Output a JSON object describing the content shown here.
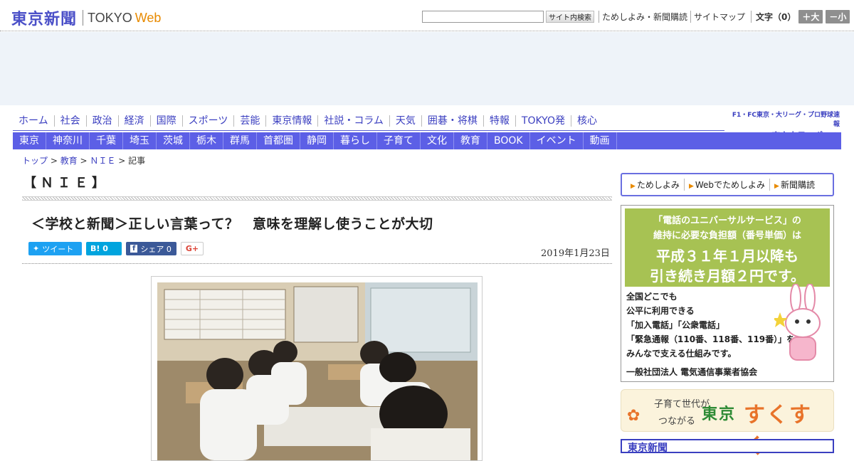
{
  "header": {
    "logo_jp": "東京新聞",
    "logo_tokyo": "TOKYO",
    "logo_web": "Web",
    "search_button": "サイト内検索",
    "links": [
      "ためしよみ・新聞購読",
      "サイトマップ"
    ],
    "font_size_label": "文字（0）",
    "font_up": "＋大",
    "font_down": "－小"
  },
  "nav_main": [
    "ホーム",
    "社会",
    "政治",
    "経済",
    "国際",
    "スポーツ",
    "芸能",
    "東京情報",
    "社説・コラム",
    "天気",
    "囲碁・将棋",
    "特報",
    "TOKYO発",
    "核心"
  ],
  "chunichi": {
    "small": "F1・FC東京・大リーグ・プロ野球速報",
    "big": "東京中日スポーツ"
  },
  "nav_local": [
    "東京",
    "神奈川",
    "千葉",
    "埼玉",
    "茨城",
    "栃木",
    "群馬",
    "首都圏",
    "静岡",
    "暮らし",
    "子育て",
    "文化",
    "教育",
    "BOOK",
    "イベント",
    "動画"
  ],
  "breadcrumb": {
    "items": [
      "トップ",
      "教育",
      "ＮＩＥ"
    ],
    "current": "記事",
    "sep": " > "
  },
  "article": {
    "section": "【ＮＩＥ】",
    "headline": "＜学校と新聞＞正しい言葉って？　意味を理解し使うことが大切",
    "date": "2019年1月23日",
    "social": {
      "tweet": "ツイート",
      "hatena": "B! 0",
      "share": "シェア 0",
      "gplus": "G+"
    }
  },
  "sidebar": {
    "links": [
      "ためしよみ",
      "Webでためしよみ",
      "新聞購読"
    ],
    "ad1": {
      "line1": "「電話のユニバーサルサービス」の",
      "line2": "維持に必要な負担額（番号単価）は",
      "line3": "平成３１年１月以降も",
      "line4": "引き続き月額２円です。",
      "body": [
        "全国どこでも",
        "公平に利用できる",
        "「加入電話」「公衆電話」",
        "「緊急通報（110番、118番、119番）」を",
        "みんなで支える仕組みです。"
      ],
      "footer": "一般社団法人 電気通信事業者協会"
    },
    "ad2": {
      "sub1": "子育て世代が",
      "sub2": "つながる",
      "tokyo": "東京",
      "sukusuku": "すくすく"
    },
    "ad3": {
      "text": "東京新聞"
    }
  },
  "colors": {
    "brand": "#4b50c8",
    "nav_bar": "#5c5fe6",
    "accent_orange": "#e88a00"
  }
}
